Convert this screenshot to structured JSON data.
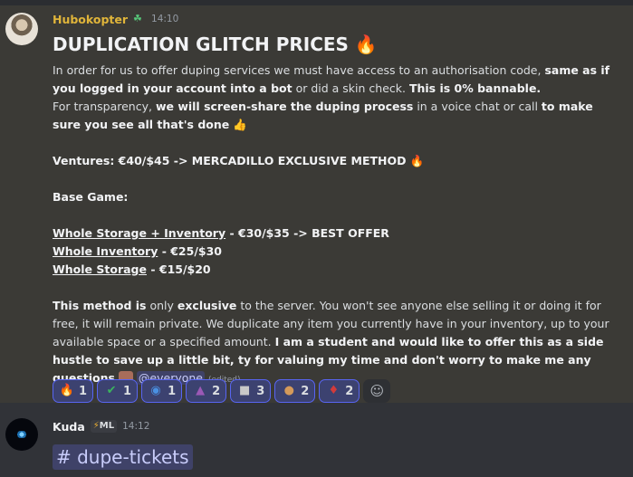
{
  "message1": {
    "username": "Hubokopter",
    "time": "14:10",
    "heading": "DUPLICATION GLITCH PRICES",
    "para1_a": "In order for us to offer duping  services we must have access to an authorisation code, ",
    "para1_b": "same as if you logged in your account into a bot",
    "para1_c": " or did a skin check. ",
    "para1_d": "This is 0% bannable.",
    "para2_a": "For transparency, ",
    "para2_b": "we will screen-share the duping process",
    "para2_c": " in a voice chat or call ",
    "para2_d": "to make sure you see all that's done",
    "ventures": "Ventures: €40/$45 -> MERCADILLO EXCLUSIVE METHOD",
    "base_game": "Base Game:",
    "line1_label": "Whole Storage + Inventory",
    "line1_rest": " - €30/$35 -> BEST OFFER",
    "line2_label": "Whole Inventory",
    "line2_rest": " - €25/$30",
    "line3_label": "Whole Storage",
    "line3_rest": " - €15/$20",
    "para3_a": "This method is",
    "para3_b": " only ",
    "para3_c": "exclusive",
    "para3_d": " to the server. You won't see anyone else selling it or doing it for free, it will remain private. We duplicate any item you currently have in your inventory, up to your available space or a specified amount. ",
    "para3_e": "I am a student and would like to offer this as a side hustle to save up a little bit, ty for valuing my time and don't worry to make me any questions",
    "mention": "@everyone",
    "edited": "(edited)",
    "reactions": [
      {
        "icon": "fire-icon",
        "glyph": "🔥",
        "count": "1"
      },
      {
        "icon": "check-icon",
        "glyph": "✔",
        "count": "1"
      },
      {
        "icon": "globe-icon",
        "glyph": "◉",
        "count": "1"
      },
      {
        "icon": "pixel-creature-icon",
        "glyph": "▲",
        "count": "2"
      },
      {
        "icon": "robot-face-icon",
        "glyph": "■",
        "count": "3"
      },
      {
        "icon": "character-face-icon",
        "glyph": "●",
        "count": "2"
      },
      {
        "icon": "red-hat-character-icon",
        "glyph": "♦",
        "count": "2"
      }
    ]
  },
  "message2": {
    "username": "Kuda",
    "role": "ML",
    "time": "14:12",
    "channel": "# dupe-tickets"
  },
  "colors": {
    "username1": "#e0b53a",
    "mention_bg": "#3f4268",
    "reaction_border": "#5865f2"
  }
}
